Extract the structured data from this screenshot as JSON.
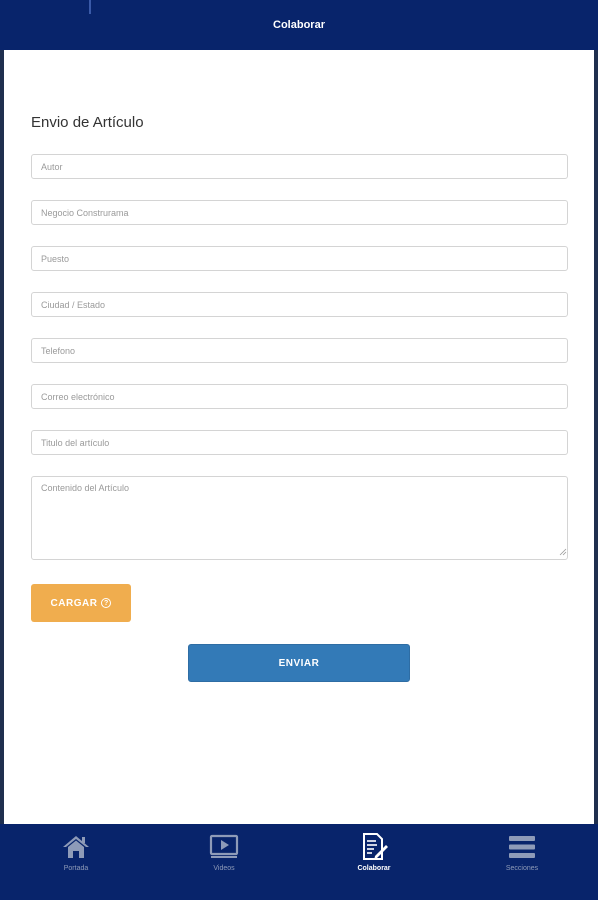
{
  "header": {
    "title": "Colaborar"
  },
  "form": {
    "title": "Envio de Artículo",
    "fields": [
      {
        "name": "autor",
        "placeholder": "Autor"
      },
      {
        "name": "negocio",
        "placeholder": "Negocio Construrama"
      },
      {
        "name": "puesto",
        "placeholder": "Puesto"
      },
      {
        "name": "ciudad",
        "placeholder": "Ciudad / Estado"
      },
      {
        "name": "telefono",
        "placeholder": "Telefono"
      },
      {
        "name": "correo",
        "placeholder": "Correo electrónico"
      },
      {
        "name": "titulo",
        "placeholder": "Titulo del artículo"
      },
      {
        "name": "contenido",
        "placeholder": "Contenido del Artículo"
      }
    ],
    "upload_label": "CARGAR",
    "upload_icon": "info-circle-icon",
    "submit_label": "ENVIAR"
  },
  "colors": {
    "header_bg": "#08246b",
    "upload_button": "#f0ad4e",
    "submit_button": "#337ab7"
  },
  "nav": {
    "items": [
      {
        "label": "Portada",
        "icon": "home-icon",
        "active": false
      },
      {
        "label": "Videos",
        "icon": "video-icon",
        "active": false
      },
      {
        "label": "Colaborar",
        "icon": "edit-document-icon",
        "active": true
      },
      {
        "label": "Secciones",
        "icon": "menu-icon",
        "active": false
      }
    ]
  }
}
